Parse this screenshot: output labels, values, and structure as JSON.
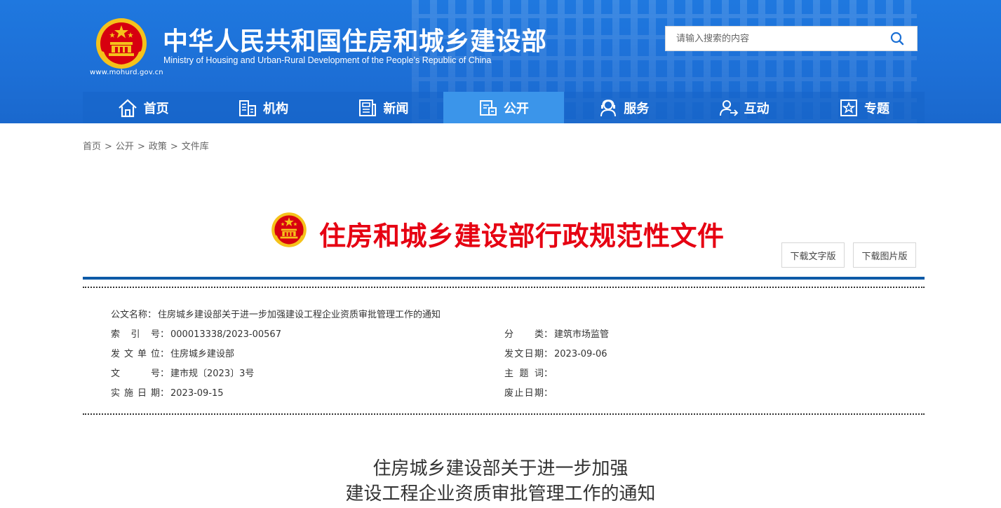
{
  "header": {
    "site_url": "www.mohurd.gov.cn",
    "title": "中华人民共和国住房和城乡建设部",
    "subtitle": "Ministry of Housing and Urban-Rural Development of the People’s Republic of China",
    "search": {
      "placeholder": "请输入搜索的内容",
      "icon": "search-icon"
    }
  },
  "nav": {
    "items": [
      {
        "label": "首页",
        "icon": "home-icon"
      },
      {
        "label": "机构",
        "icon": "building-icon"
      },
      {
        "label": "新闻",
        "icon": "news-icon"
      },
      {
        "label": "公开",
        "icon": "disclosure-icon",
        "active": true
      },
      {
        "label": "服务",
        "icon": "service-icon"
      },
      {
        "label": "互动",
        "icon": "interaction-icon"
      },
      {
        "label": "专题",
        "icon": "star-icon"
      }
    ]
  },
  "breadcrumb": {
    "items": [
      "首页",
      "公开",
      "政策",
      "文件库"
    ],
    "separator": ">"
  },
  "doc": {
    "banner_title": "住房和城乡建设部行政规范性文件",
    "download_text": "下载文字版",
    "download_image": "下载图片版",
    "meta": {
      "name_label": "公文名称",
      "name_value": "住房城乡建设部关于进一步加强建设工程企业资质审批管理工作的通知",
      "index_label": "索 引 号",
      "index_value": "000013338/2023-00567",
      "category_label": "分 类",
      "category_value": "建筑市场监管",
      "issuer_label": "发文单位",
      "issuer_value": "住房城乡建设部",
      "issue_date_label": "发文日期",
      "issue_date_value": "2023-09-06",
      "doc_no_label": "文 号",
      "doc_no_value": "建市规〔2023〕3号",
      "keywords_label": "主 题 词",
      "keywords_value": "",
      "effective_label": "实施日期",
      "effective_value": "2023-09-15",
      "expiry_label": "废止日期",
      "expiry_value": ""
    },
    "body_title_line1": "住房城乡建设部关于进一步加强",
    "body_title_line2": "建设工程企业资质审批管理工作的通知"
  },
  "colors": {
    "header_blue": "#1f78df",
    "nav_active": "#3b95ea",
    "banner_red": "#e60012",
    "rule_blue": "#0d5aa7"
  }
}
